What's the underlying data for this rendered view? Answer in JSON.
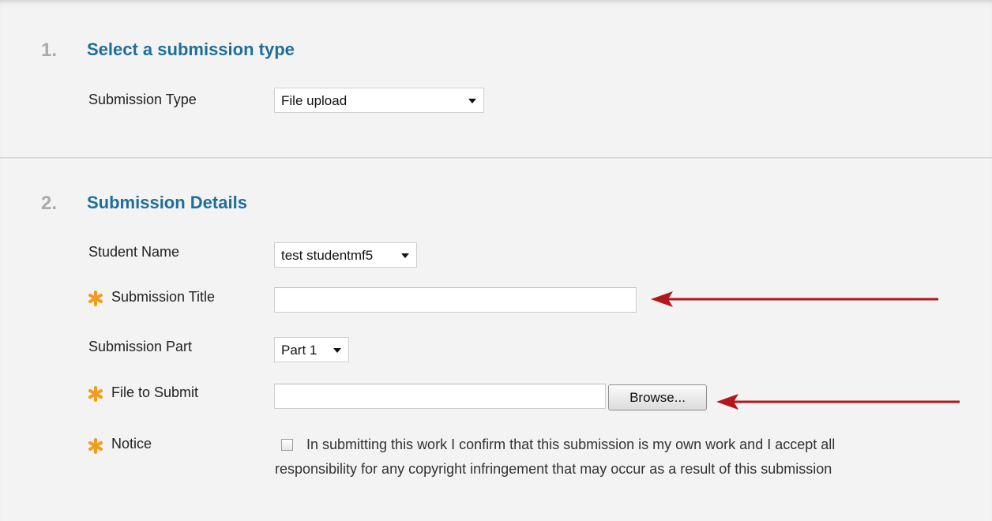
{
  "section1": {
    "number": "1.",
    "title": "Select a submission type",
    "submission_type_label": "Submission Type",
    "submission_type_value": "File upload"
  },
  "section2": {
    "number": "2.",
    "title": "Submission Details",
    "student_name_label": "Student Name",
    "student_name_value": "test studentmf5",
    "submission_title_label": "Submission Title",
    "submission_title_value": "",
    "submission_part_label": "Submission Part",
    "submission_part_value": "Part 1",
    "file_label": "File to Submit",
    "file_value": "",
    "browse_label": "Browse...",
    "notice_label": "Notice",
    "notice_line1": "In submitting this work I confirm that this submission is my own work and I accept all",
    "notice_line2": "responsibility for any copyright infringement that may occur as a result of this submission",
    "notice_checked": false
  },
  "icons": {
    "required": "asterisk-icon",
    "dropdown": "chevron-down-icon",
    "annotation": "arrow-left-icon"
  },
  "colors": {
    "heading": "#1f6e9a",
    "step_number": "#a9a9a9",
    "required": "#f39b1c",
    "annotation_arrow": "#b3161b",
    "panel_background": "#f3f3f3"
  }
}
